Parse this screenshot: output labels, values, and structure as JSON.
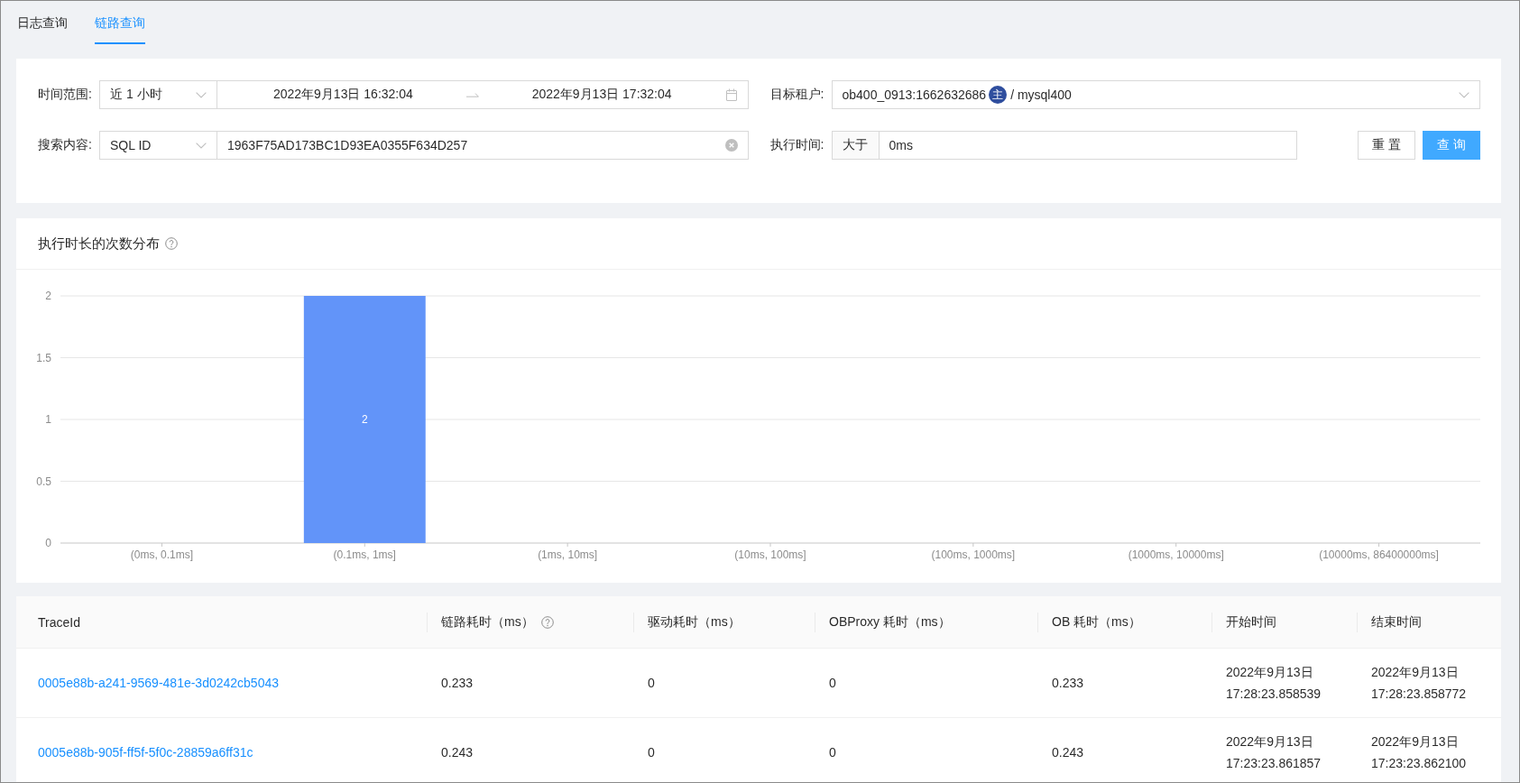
{
  "tabs": [
    {
      "label": "日志查询",
      "selected": false
    },
    {
      "label": "链路查询",
      "selected": true
    }
  ],
  "filter_form": {
    "time_range": {
      "label": "时间范围:",
      "preset": "近 1 小时",
      "start": "2022年9月13日 16:32:04",
      "end": "2022年9月13日 17:32:04"
    },
    "target_tenant": {
      "label": "目标租户:",
      "tenant": "ob400_0913:1662632686",
      "role_badge": "主",
      "database": "/ mysql400"
    },
    "search_content": {
      "label": "搜索内容:",
      "type": "SQL ID",
      "value": "1963F75AD173BC1D93EA0355F634D257"
    },
    "execution_time": {
      "label": "执行时间:",
      "operator": "大于",
      "value": "0ms"
    },
    "buttons": [
      {
        "label": "重 置",
        "kind": "default"
      },
      {
        "label": "查 询",
        "kind": "primary"
      }
    ]
  },
  "chart": {
    "chart_data": {
      "type": "bar",
      "title": "执行时长的次数分布",
      "categories": [
        "(0ms, 0.1ms]",
        "(0.1ms, 1ms]",
        "(1ms, 10ms]",
        "(10ms, 100ms]",
        "(100ms, 1000ms]",
        "(1000ms, 10000ms]",
        "(10000ms, 86400000ms]"
      ],
      "series": [
        {
          "color": "#6294f9",
          "values": [
            0,
            2,
            0,
            0,
            0,
            0,
            0
          ]
        }
      ],
      "ylim": [
        0,
        2
      ],
      "yticks": [
        0,
        0.5,
        1,
        1.5,
        2
      ],
      "grid": true,
      "value_labels": [
        null,
        "2",
        null,
        null,
        null,
        null,
        null
      ]
    }
  },
  "table": {
    "columns": [
      {
        "label": "TraceId",
        "kind": "link",
        "help": false
      },
      {
        "label": "链路耗时（ms）",
        "kind": "text",
        "help": true
      },
      {
        "label": "驱动耗时（ms）",
        "kind": "text",
        "help": false
      },
      {
        "label": "OBProxy 耗时（ms）",
        "kind": "text",
        "help": false
      },
      {
        "label": "OB 耗时（ms）",
        "kind": "text",
        "help": false
      },
      {
        "label": "开始时间",
        "kind": "text",
        "help": false
      },
      {
        "label": "结束时间",
        "kind": "text",
        "help": false
      }
    ],
    "rows": [
      {
        "cells": [
          "0005e88b-a241-9569-481e-3d0242cb5043",
          "0.233",
          "0",
          "0",
          "0.233",
          "2022年9月13日 17:28:23.858539",
          "2022年9月13日 17:28:23.858772"
        ]
      },
      {
        "cells": [
          "0005e88b-905f-ff5f-5f0c-28859a6ff31c",
          "0.243",
          "0",
          "0",
          "0.243",
          "2022年9月13日 17:23:23.861857",
          "2022年9月13日 17:23:23.862100"
        ]
      }
    ]
  }
}
